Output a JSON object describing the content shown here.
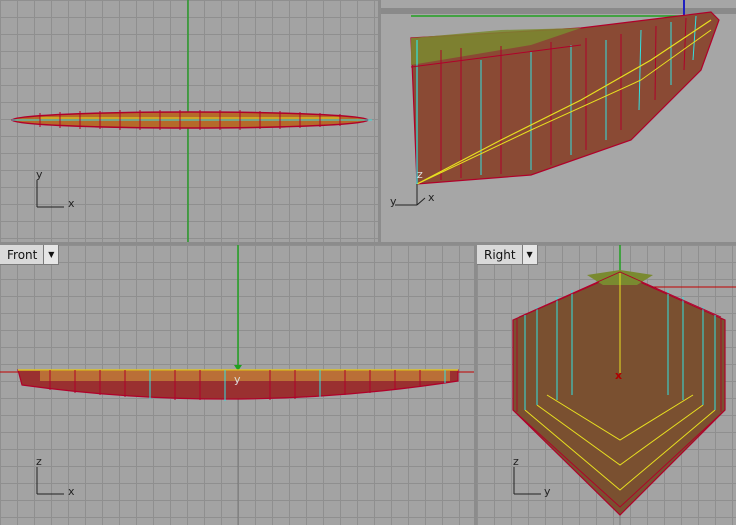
{
  "viewports": {
    "top": {
      "tab": null,
      "axis_h": "x",
      "axis_v": "y"
    },
    "persp": {
      "tab": null,
      "axis_h": "x",
      "axis_v": "y",
      "origin": "z"
    },
    "front": {
      "tab": "Front",
      "axis_h": "x",
      "axis_v": "z",
      "marker": "y"
    },
    "right": {
      "tab": "Right",
      "axis_h": "y",
      "axis_v": "z",
      "marker": "x"
    }
  },
  "icons": {
    "viewport_menu": "chevron-down-icon"
  },
  "colors": {
    "grid_bg": "#a3a3a3",
    "grid_line": "#8f8f8f",
    "hull_edge": "#b0002a",
    "hull_fill": "#9a3a2f",
    "iso_cyan": "#33e0e0",
    "iso_yellow": "#e8e020",
    "axis_green": "#20a020",
    "axis_red": "#c00000"
  }
}
